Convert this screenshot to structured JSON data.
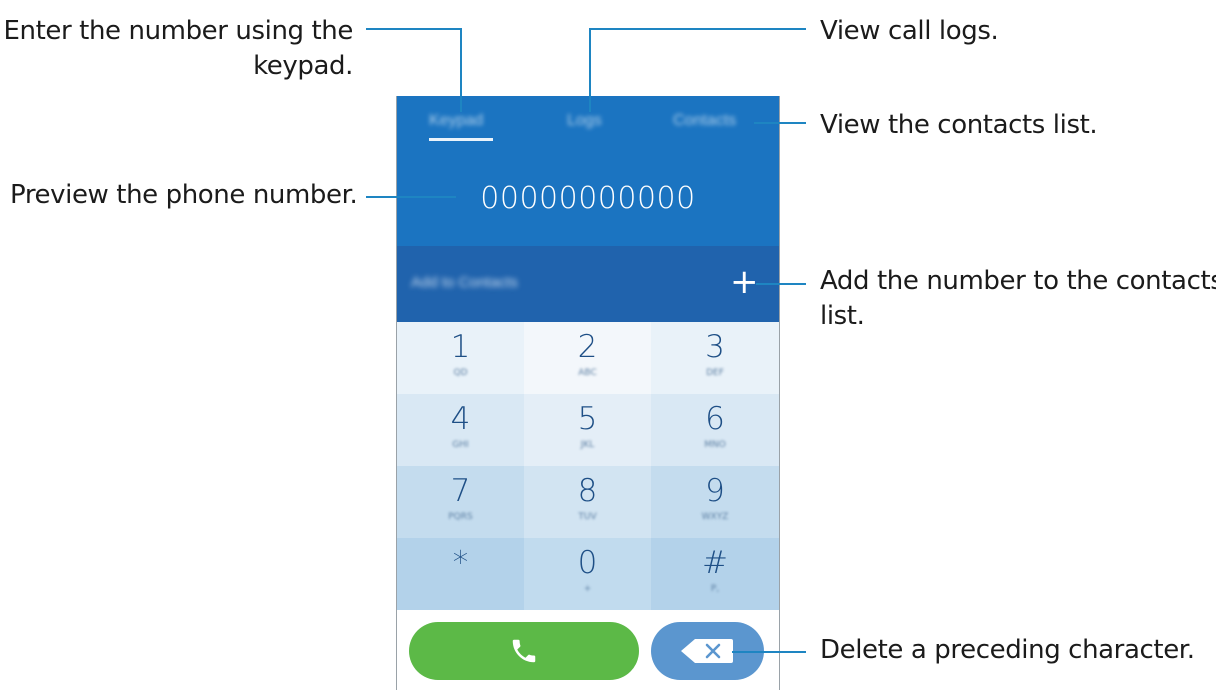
{
  "callouts": {
    "keypad_line1": "Enter the number using the",
    "keypad_line2": "keypad.",
    "logs": "View call logs.",
    "contacts": "View the contacts list.",
    "preview": "Preview the phone number.",
    "add_line1": "Add the number to the contacts",
    "add_line2": "list.",
    "delete": "Delete a preceding character."
  },
  "phone": {
    "tabs": [
      "Keypad",
      "Logs",
      "Contacts"
    ],
    "number": "00000000000",
    "add_to_contacts": "Add to Contacts",
    "add_icon": "+",
    "keys": [
      {
        "digit": "1",
        "letters": "QD"
      },
      {
        "digit": "2",
        "letters": "ABC"
      },
      {
        "digit": "3",
        "letters": "DEF"
      },
      {
        "digit": "4",
        "letters": "GHI"
      },
      {
        "digit": "5",
        "letters": "JKL"
      },
      {
        "digit": "6",
        "letters": "MNO"
      },
      {
        "digit": "7",
        "letters": "PQRS"
      },
      {
        "digit": "8",
        "letters": "TUV"
      },
      {
        "digit": "9",
        "letters": "WXYZ"
      },
      {
        "digit": "*",
        "letters": ""
      },
      {
        "digit": "0",
        "letters": "+"
      },
      {
        "digit": "#",
        "letters": "P,"
      }
    ],
    "call_icon": "phone-icon",
    "delete_icon": "backspace-icon"
  },
  "colors": {
    "accent": "#1b74c1",
    "callout_line": "#1e85c2",
    "call_button": "#5cb947",
    "delete_button": "#5b96cf"
  }
}
